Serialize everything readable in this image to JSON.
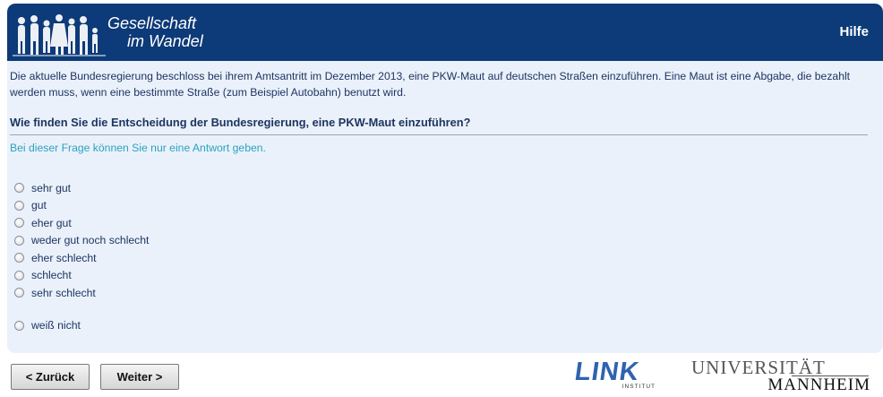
{
  "header": {
    "logo_line1": "Gesellschaft",
    "logo_line2": "im Wandel",
    "help_label": "Hilfe"
  },
  "intro_text": "Die aktuelle Bundesregierung beschloss bei ihrem Amtsantritt im Dezember 2013, eine PKW-Maut auf deutschen Straßen einzuführen. Eine Maut ist eine Abgabe, die bezahlt werden muss, wenn eine bestimmte Straße (zum Beispiel Autobahn) benutzt wird.",
  "question": "Wie finden Sie die Entscheidung der Bundesregierung, eine PKW-Maut einzuführen?",
  "hint": "Bei dieser Frage können Sie nur eine Antwort geben.",
  "options": [
    "sehr gut",
    "gut",
    "eher gut",
    "weder gut noch schlecht",
    "eher schlecht",
    "schlecht",
    "sehr schlecht"
  ],
  "dont_know": "weiß nicht",
  "nav": {
    "back_label": "< Zurück",
    "next_label": "Weiter >"
  },
  "logos": {
    "link": "LINK",
    "link_sub": "INSTITUT",
    "uni_top": "UNIVERSITÄT",
    "uni_bottom": "MANNHEIM"
  },
  "colors": {
    "header_bg": "#0d3a78",
    "panel_bg": "#eaf1fb",
    "hint": "#2aa3bd",
    "link_logo": "#2f63b0"
  }
}
